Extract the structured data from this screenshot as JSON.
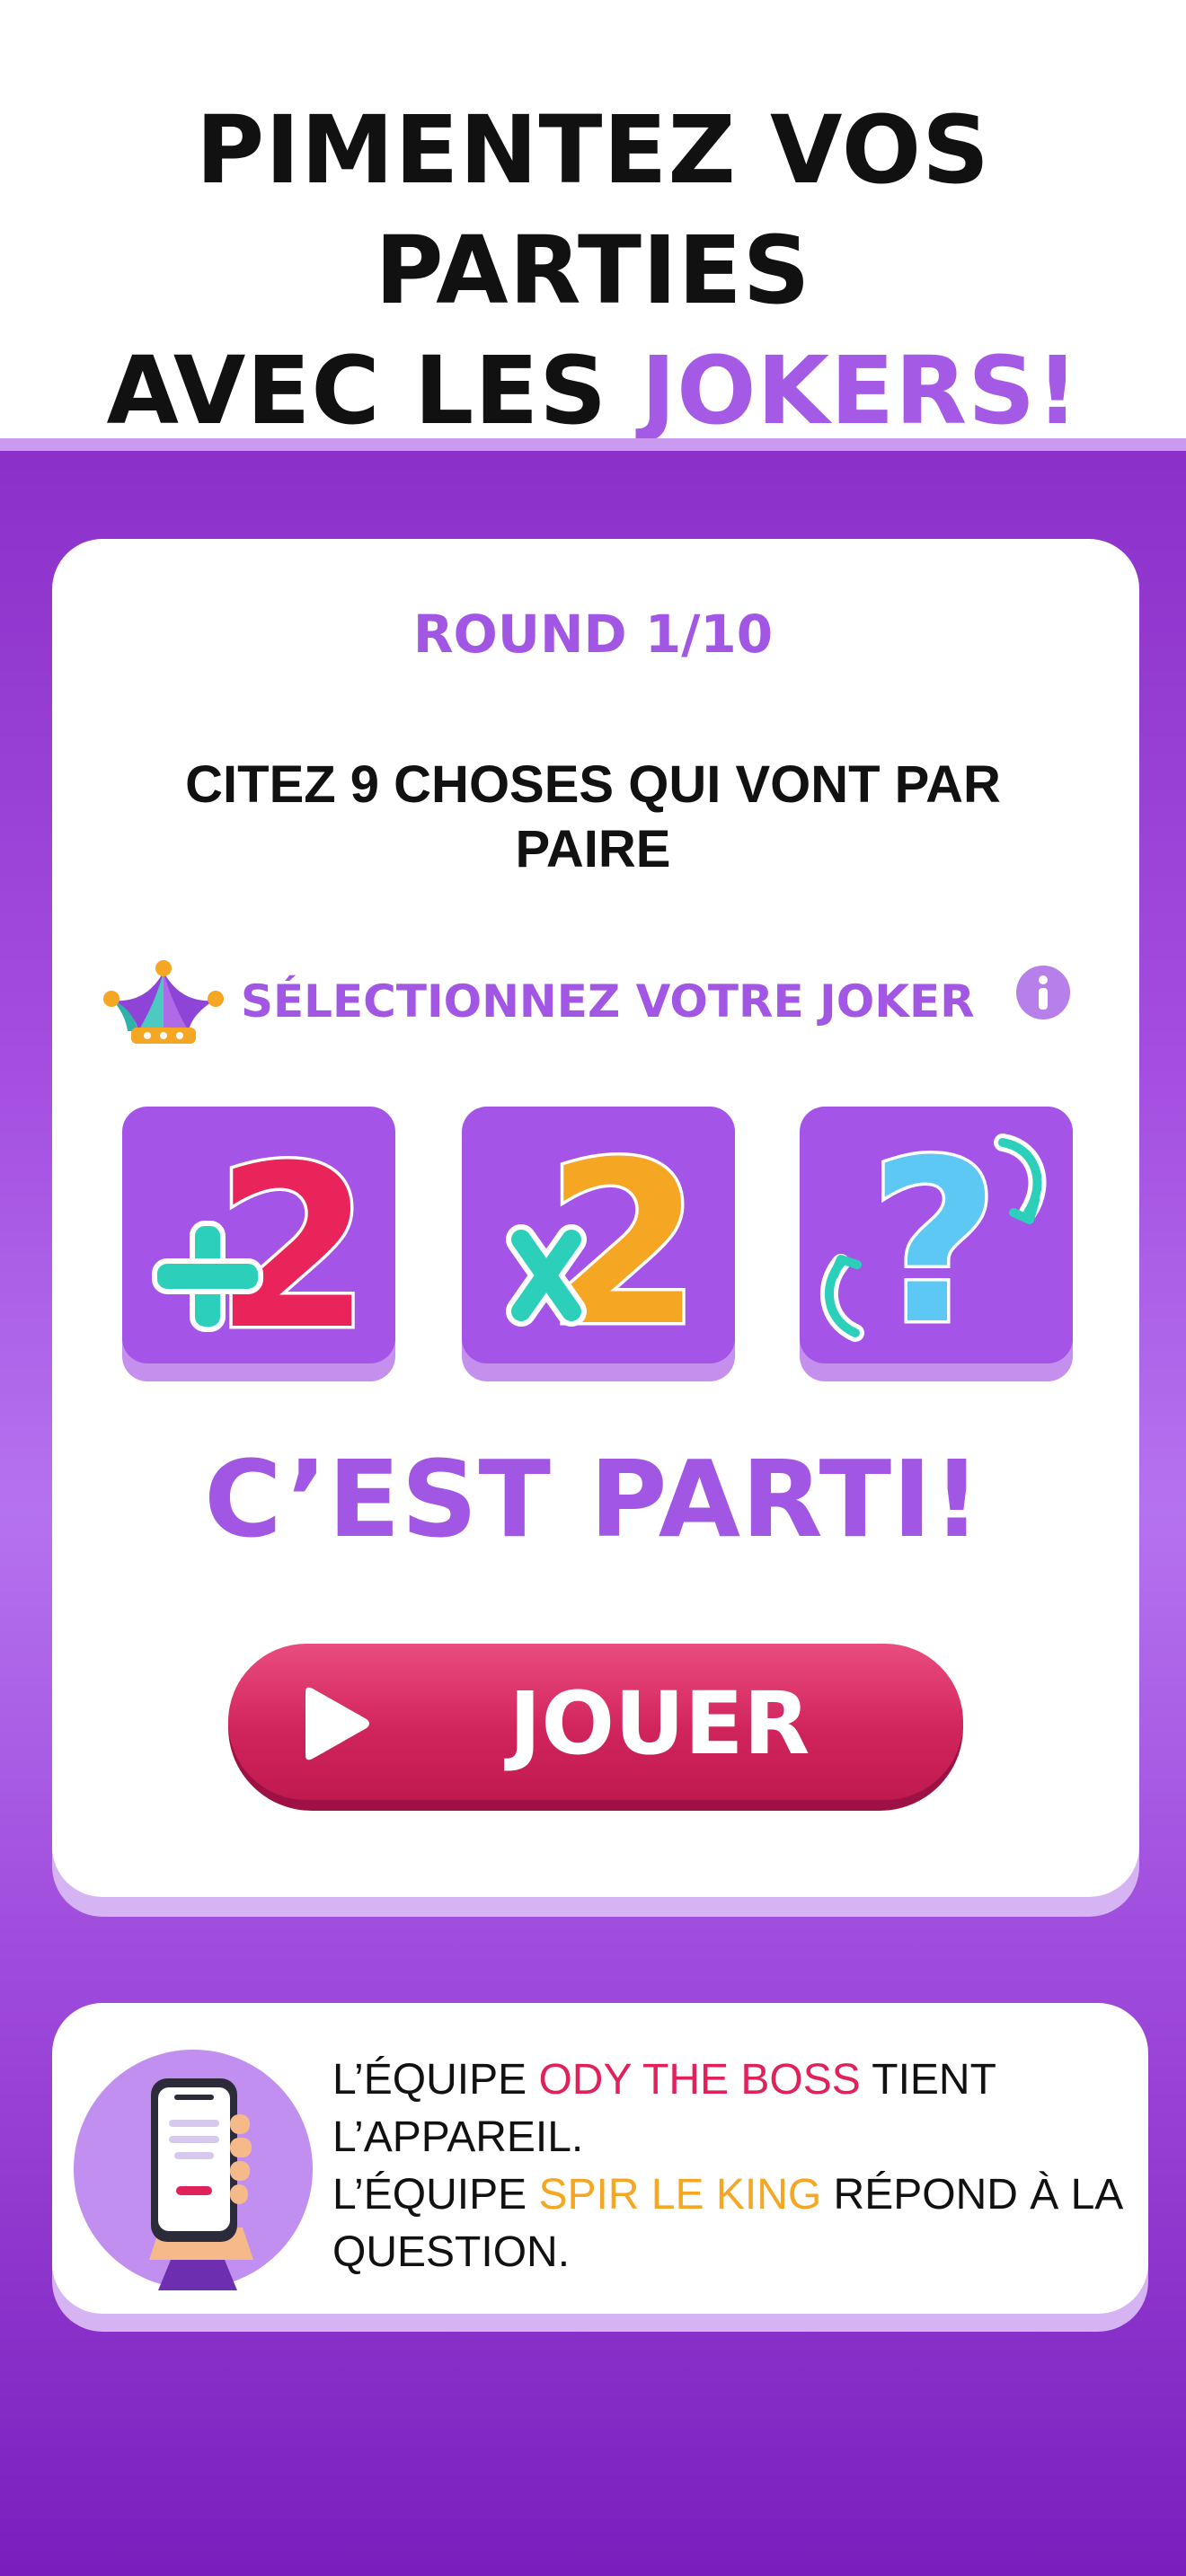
{
  "header": {
    "line1": "PIMENTEZ VOS PARTIES",
    "line2_prefix": "AVEC LES ",
    "line2_accent": "JOKERS!"
  },
  "game": {
    "round_label": "ROUND 1/10",
    "question": "CITEZ 9 CHOSES QUI VONT PAR PAIRE",
    "joker_prompt": "SÉLECTIONNEZ VOTRE JOKER",
    "jokers": [
      {
        "icon": "plus-two-icon"
      },
      {
        "icon": "times-two-icon"
      },
      {
        "icon": "question-swap-icon"
      }
    ],
    "go_text": "C’EST PARTI!",
    "play_button_label": "JOUER"
  },
  "teams": {
    "line1_prefix": "L’ÉQUIPE ",
    "holder_team": "ODY THE BOSS",
    "line1_suffix": " TIENT L’APPAREIL.",
    "line2_prefix": "L’ÉQUIPE ",
    "answer_team": "SPIR LE KING",
    "line2_suffix": " RÉPOND À LA QUESTION."
  },
  "colors": {
    "accent_purple": "#a257e4",
    "play_pink": "#d1245d",
    "team_pink": "#e0225a",
    "team_orange": "#f5a623",
    "background_purple": "#8b2fc9"
  }
}
